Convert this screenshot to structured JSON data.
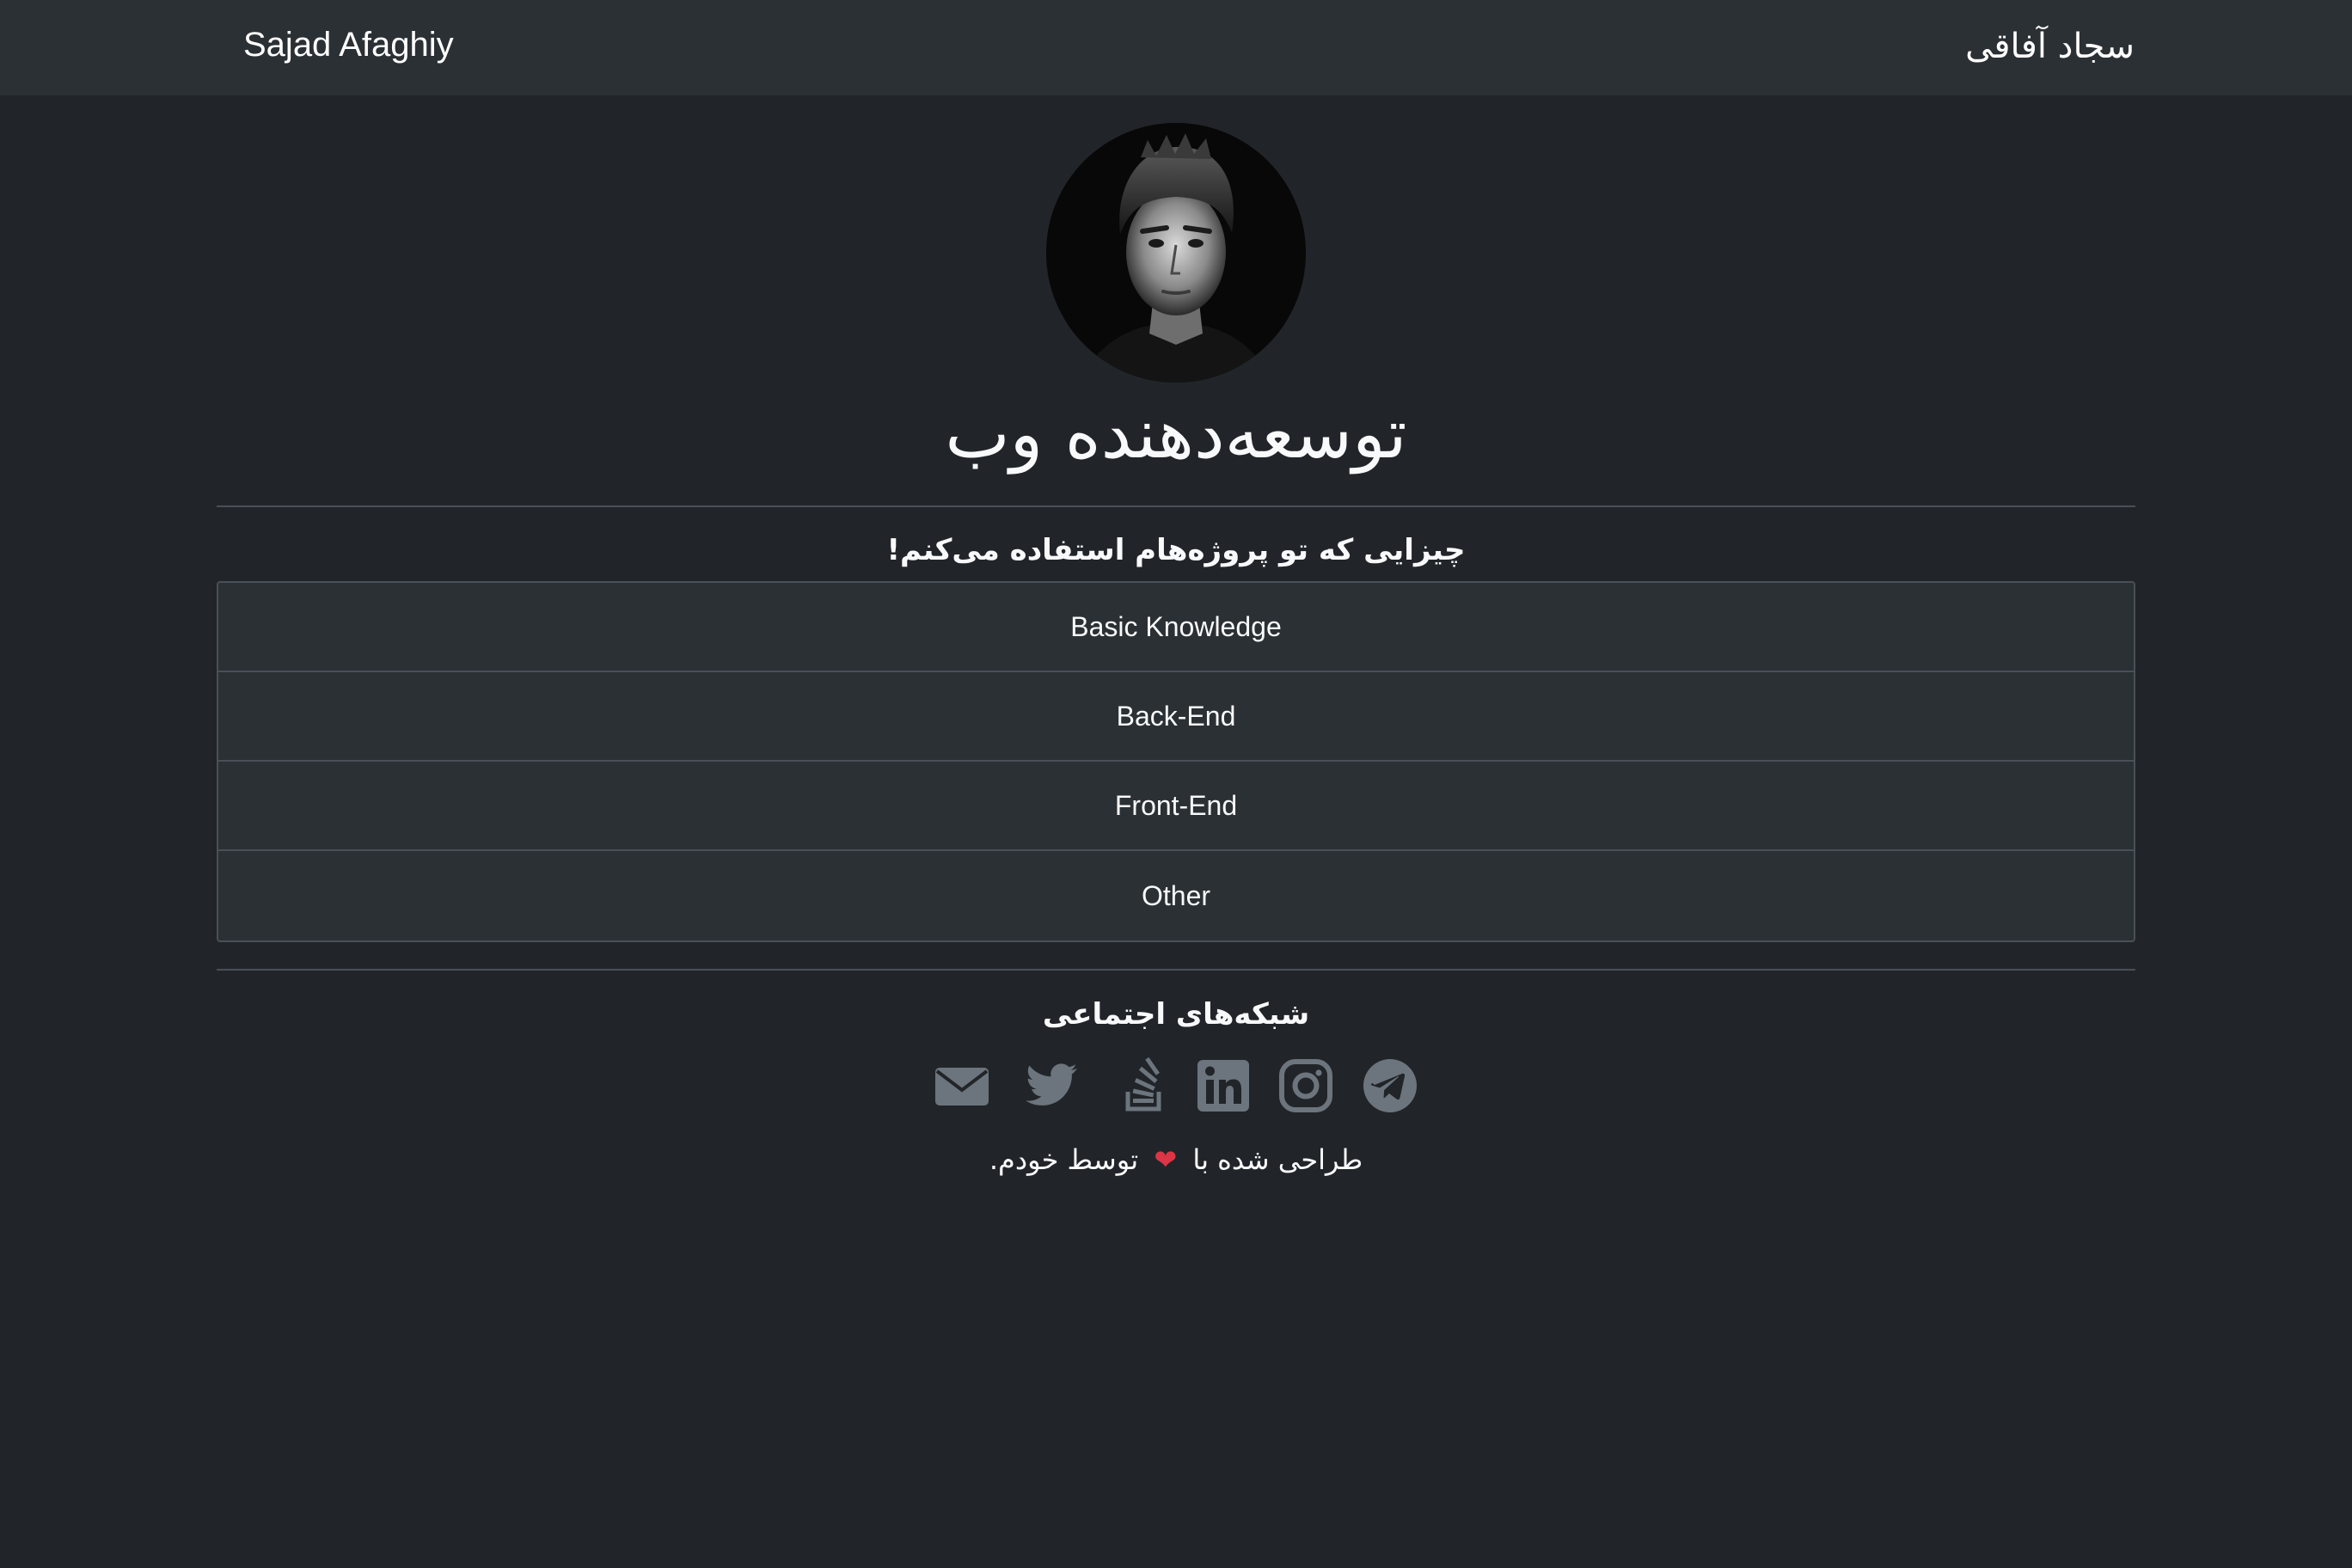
{
  "navbar": {
    "brand_en": "Sajad Afaghiy",
    "brand_fa": "سجاد آفاقی"
  },
  "profile": {
    "avatar_icon": "profile-photo",
    "title": "توسعه‌دهنده وب"
  },
  "tools": {
    "heading": "چیزایی که تو پروژه‌هام استفاده می‌کنم!",
    "items": [
      "Basic Knowledge",
      "Back-End",
      "Front-End",
      "Other"
    ]
  },
  "social": {
    "heading": "شبکه‌های اجتماعی",
    "icons": [
      "email-icon",
      "twitter-icon",
      "stackoverflow-icon",
      "linkedin-icon",
      "instagram-icon",
      "telegram-icon"
    ],
    "icon_color": "#6c757d"
  },
  "footer": {
    "before": "طراحی شده با",
    "heart": "❤",
    "after": "توسط خودم."
  },
  "colors": {
    "background": "#212529",
    "navbar": "#2b3035",
    "border": "#495057",
    "heart": "#dc3545"
  }
}
